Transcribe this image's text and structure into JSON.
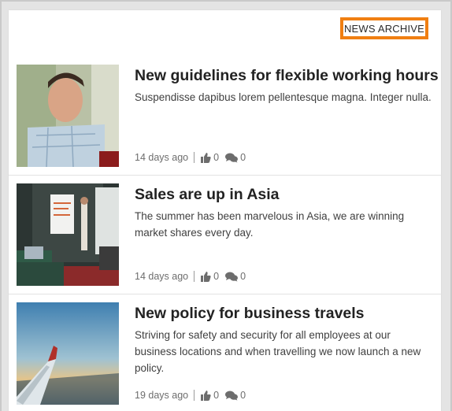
{
  "archive_button": "NEWS ARCHIVE",
  "items": [
    {
      "title": "New guidelines for flexible working hours",
      "description": "Suspendisse dapibus lorem pellentesque magna. Integer nulla.",
      "age": "14 days ago",
      "likes": "0",
      "comments": "0"
    },
    {
      "title": "Sales are up in Asia",
      "description": "The summer has been marvelous in Asia, we are winning market shares every day.",
      "age": "14 days ago",
      "likes": "0",
      "comments": "0"
    },
    {
      "title": "New policy for business travels",
      "description": "Striving for safety and security for all employees at our business locations and when travelling we now launch a new policy.",
      "age": "19 days ago",
      "likes": "0",
      "comments": "0"
    }
  ],
  "colors": {
    "accent": "#f07f12",
    "divider": "#e2e2e2"
  },
  "icons": {
    "like": "thumbs-up-icon",
    "comment": "comments-icon"
  }
}
